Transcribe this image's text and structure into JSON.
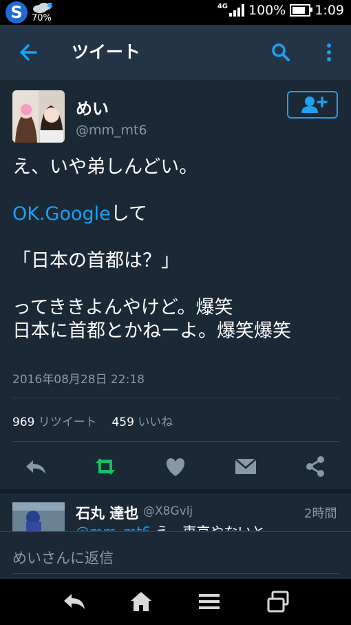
{
  "status_bar": {
    "app_letter": "S",
    "weather_percent": "70%",
    "network": "4G",
    "battery": "100%",
    "battery_level": 1.0,
    "time": "1:09"
  },
  "app_bar": {
    "title": "ツイート",
    "back_icon": "arrow-left-icon",
    "search_icon": "search-icon",
    "more_icon": "more-vert-icon"
  },
  "tweet": {
    "author_name": "めい",
    "author_handle": "@mm_mt6",
    "follow_icon": "add-user-icon",
    "line1": "え、いや弟しんどい。",
    "line2_link": "OK.Google",
    "line2_rest": "して",
    "line3": "「日本の首都は？」",
    "line4": "ってききよんやけど。爆笑",
    "line5": "日本に首都とかねーよ。爆笑爆笑",
    "timestamp": "2016年08月28日 22:18",
    "retweet_count": "969",
    "retweet_label": "リツイート",
    "like_count": "459",
    "like_label": "いいね"
  },
  "actions": [
    "reply-icon",
    "retweet-icon",
    "heart-icon",
    "mail-icon",
    "share-icon"
  ],
  "reply": {
    "name": "石丸 達也",
    "handle": "@X8Gvlj",
    "time": "2時間",
    "mention": "@mm_mt6",
    "text": " え、東京やないと"
  },
  "compose": {
    "placeholder": "めいさんに返信"
  },
  "nav_bar": [
    "back-icon",
    "home-icon",
    "menu-icon",
    "recent-apps-icon"
  ],
  "colors": {
    "accent": "#1da1f2",
    "retweet_green": "#17bf63",
    "background": "#1b2836",
    "header": "#243447"
  }
}
